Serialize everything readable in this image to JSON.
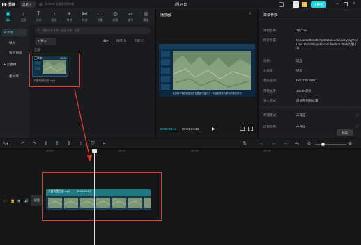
{
  "app": {
    "name": "剪映",
    "menu_label": "菜单",
    "autosave": "11:45:16 自动保存到本地",
    "project_title": "7月14日",
    "export_label": "导出"
  },
  "toolbar": {
    "tabs": [
      {
        "label": "媒体",
        "icon": "media-icon"
      },
      {
        "label": "音频",
        "icon": "audio-icon"
      },
      {
        "label": "文本",
        "icon": "text-icon"
      },
      {
        "label": "贴纸",
        "icon": "sticker-icon"
      },
      {
        "label": "特效",
        "icon": "effects-icon"
      },
      {
        "label": "转场",
        "icon": "transition-icon"
      },
      {
        "label": "字幕",
        "icon": "caption-icon"
      },
      {
        "label": "滤镜",
        "icon": "filter-icon"
      },
      {
        "label": "调节",
        "icon": "adjust-icon"
      },
      {
        "label": "模板",
        "icon": "template-icon"
      }
    ]
  },
  "left_nav": {
    "items": [
      "本地",
      "导入",
      "我的预设",
      "云素材",
      "素材库"
    ]
  },
  "media": {
    "search_placeholder": "搜索文件名称、画面元素、标签",
    "import_label": "导入",
    "sort_label": "排序",
    "filter_label": "全部",
    "all_label": "全部",
    "clip": {
      "badge": "已添加",
      "duration": "00:25",
      "filename": "大唐的唐伯虎.mp4"
    }
  },
  "player": {
    "title": "播放器",
    "subtitle": "在游的中端的就是我是在里面只显示了一年全部数字代表年的现在情况",
    "current_time": "00:00:09:16",
    "total_time": "00:01:24:22"
  },
  "properties": {
    "title": "草稿参数",
    "rows": [
      {
        "key": "草稿名称:",
        "value": "7月14日"
      },
      {
        "key": "保存位置:",
        "value": "C:/Users/86138/AppData/Local/JianyingPro/User Data/Projects/com.lveditor.draft/7月14日"
      },
      {
        "key": "比例:",
        "value": "适应"
      },
      {
        "key": "分辨率:",
        "value": "适应"
      },
      {
        "key": "色彩空间:",
        "value": "Rec.709 SDR"
      },
      {
        "key": "草稿帧率:",
        "value": "30.00帧/秒"
      },
      {
        "key": "导入方式:",
        "value": "保留在原有位置"
      },
      {
        "key": "代理模式:",
        "value": "未开启"
      },
      {
        "key": "自由层级:",
        "value": "未开启"
      }
    ],
    "edit_label": "修改"
  },
  "timeline": {
    "ruler": [
      "|00:00",
      "|00:10",
      "|00:20",
      "|00:30"
    ],
    "cover_label": "封面",
    "clip": {
      "name": "大唐的唐伯虎.mp4",
      "duration": "00:01:24:22"
    }
  },
  "colors": {
    "accent": "#21d0dc",
    "highlight": "#e03c2d",
    "clip_bg": "#1d7a80"
  }
}
